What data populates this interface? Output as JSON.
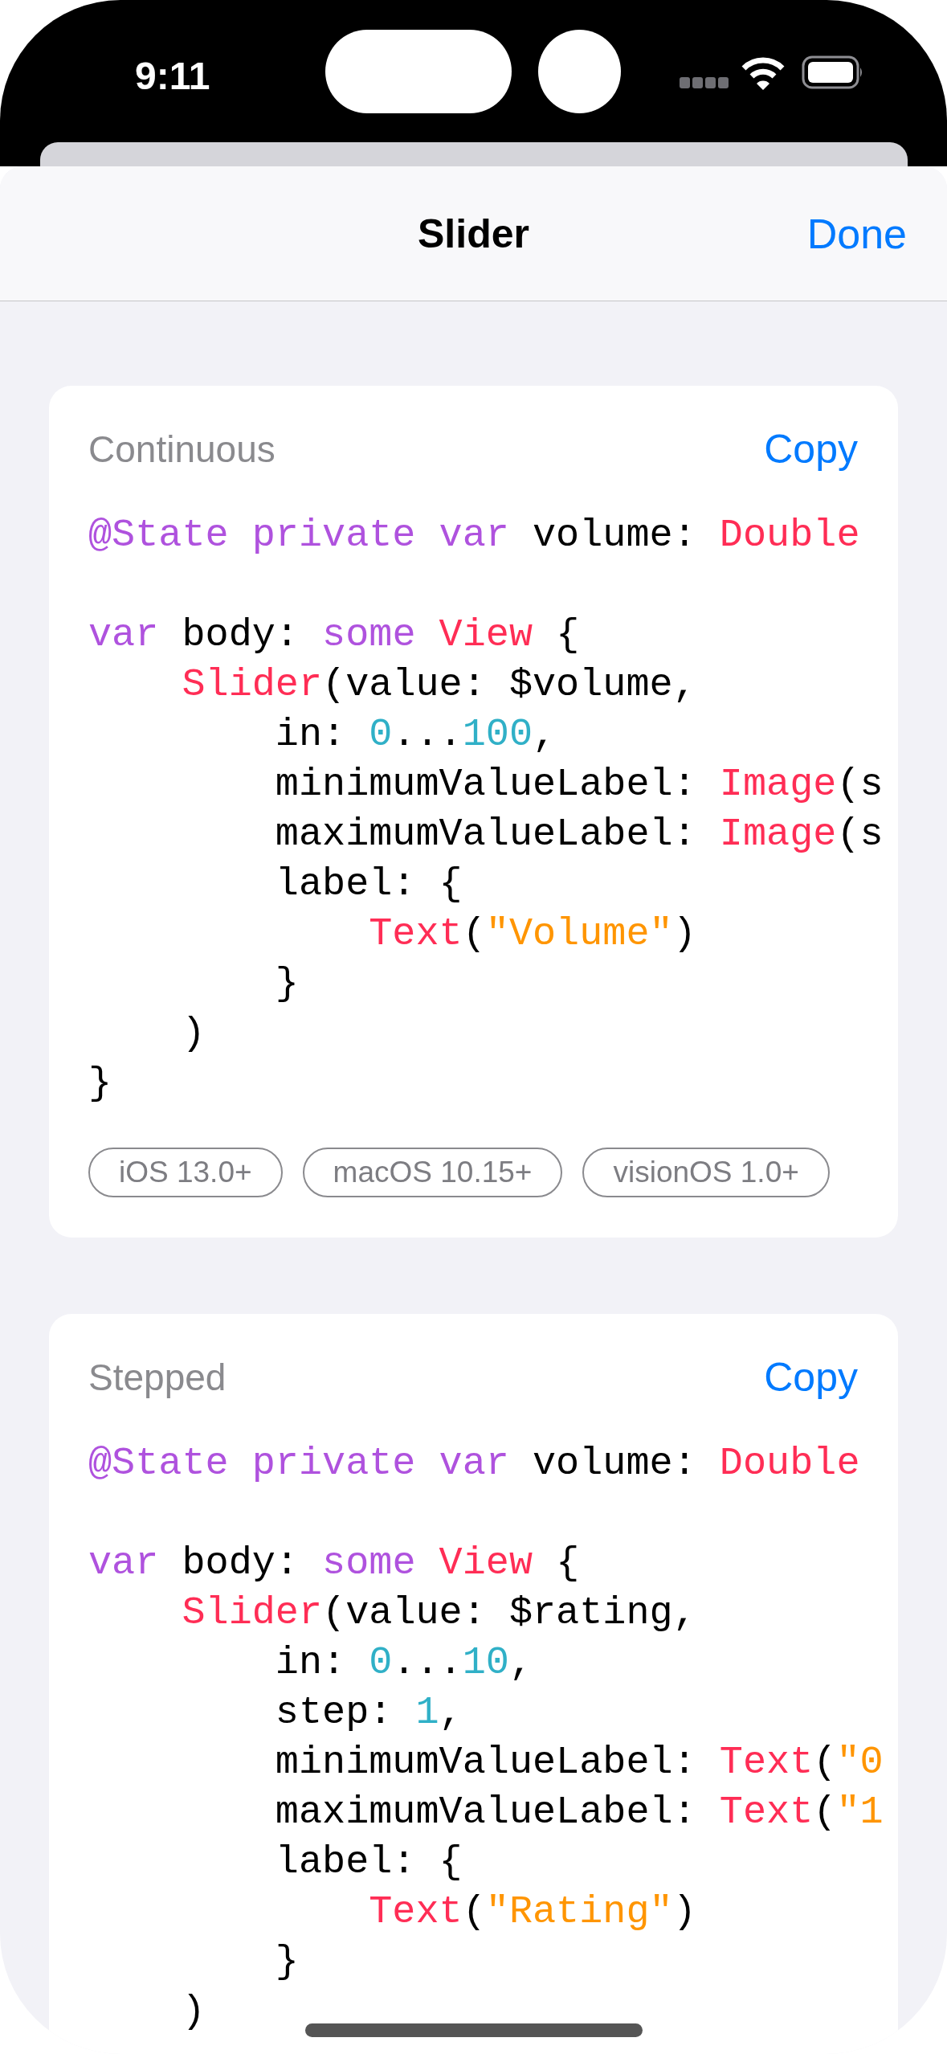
{
  "status_bar": {
    "time": "9:11"
  },
  "header": {
    "title": "Slider",
    "done": "Done"
  },
  "cards": [
    {
      "title": "Continuous",
      "copy": "Copy",
      "lines": [
        {
          "gap_before": false,
          "tokens": [
            {
              "text": "@State",
              "kind": "keyword"
            },
            {
              "text": " private",
              "kind": "keyword"
            },
            {
              "text": " var",
              "kind": "keyword"
            },
            {
              "text": " volume:",
              "kind": "plain"
            },
            {
              "text": " Double",
              "kind": "type"
            }
          ]
        },
        {
          "gap_before": true,
          "tokens": [
            {
              "text": "var",
              "kind": "keyword"
            },
            {
              "text": " body:",
              "kind": "plain"
            },
            {
              "text": " some",
              "kind": "keyword"
            },
            {
              "text": " View",
              "kind": "type"
            },
            {
              "text": " {",
              "kind": "plain"
            }
          ]
        },
        {
          "gap_before": false,
          "tokens": [
            {
              "text": "    Slider",
              "kind": "type"
            },
            {
              "text": "(value: $volume,",
              "kind": "plain"
            }
          ]
        },
        {
          "gap_before": false,
          "tokens": [
            {
              "text": "        in:",
              "kind": "plain"
            },
            {
              "text": " 0",
              "kind": "number"
            },
            {
              "text": "...",
              "kind": "plain"
            },
            {
              "text": "100",
              "kind": "number"
            },
            {
              "text": ",",
              "kind": "plain"
            }
          ]
        },
        {
          "gap_before": false,
          "tokens": [
            {
              "text": "        minimumValueLabel:",
              "kind": "plain"
            },
            {
              "text": " Image",
              "kind": "type"
            },
            {
              "text": "(s",
              "kind": "plain"
            }
          ]
        },
        {
          "gap_before": false,
          "tokens": [
            {
              "text": "        maximumValueLabel:",
              "kind": "plain"
            },
            {
              "text": " Image",
              "kind": "type"
            },
            {
              "text": "(s",
              "kind": "plain"
            }
          ]
        },
        {
          "gap_before": false,
          "tokens": [
            {
              "text": "        label: {",
              "kind": "plain"
            }
          ]
        },
        {
          "gap_before": false,
          "tokens": [
            {
              "text": "            Text",
              "kind": "type"
            },
            {
              "text": "(",
              "kind": "plain"
            },
            {
              "text": "\"Volume\"",
              "kind": "string"
            },
            {
              "text": ")",
              "kind": "plain"
            }
          ]
        },
        {
          "gap_before": false,
          "tokens": [
            {
              "text": "        }",
              "kind": "plain"
            }
          ]
        },
        {
          "gap_before": false,
          "tokens": [
            {
              "text": "    )",
              "kind": "plain"
            }
          ]
        },
        {
          "gap_before": false,
          "tokens": [
            {
              "text": "}",
              "kind": "plain"
            }
          ]
        }
      ],
      "platforms": [
        "iOS 13.0+",
        "macOS 10.15+",
        "visionOS 1.0+"
      ]
    },
    {
      "title": "Stepped",
      "copy": "Copy",
      "lines": [
        {
          "gap_before": false,
          "tokens": [
            {
              "text": "@State",
              "kind": "keyword"
            },
            {
              "text": " private",
              "kind": "keyword"
            },
            {
              "text": " var",
              "kind": "keyword"
            },
            {
              "text": " volume:",
              "kind": "plain"
            },
            {
              "text": " Double",
              "kind": "type"
            }
          ]
        },
        {
          "gap_before": true,
          "tokens": [
            {
              "text": "var",
              "kind": "keyword"
            },
            {
              "text": " body:",
              "kind": "plain"
            },
            {
              "text": " some",
              "kind": "keyword"
            },
            {
              "text": " View",
              "kind": "type"
            },
            {
              "text": " {",
              "kind": "plain"
            }
          ]
        },
        {
          "gap_before": false,
          "tokens": [
            {
              "text": "    Slider",
              "kind": "type"
            },
            {
              "text": "(value: $rating,",
              "kind": "plain"
            }
          ]
        },
        {
          "gap_before": false,
          "tokens": [
            {
              "text": "        in:",
              "kind": "plain"
            },
            {
              "text": " 0",
              "kind": "number"
            },
            {
              "text": "...",
              "kind": "plain"
            },
            {
              "text": "10",
              "kind": "number"
            },
            {
              "text": ",",
              "kind": "plain"
            }
          ]
        },
        {
          "gap_before": false,
          "tokens": [
            {
              "text": "        step:",
              "kind": "plain"
            },
            {
              "text": " 1",
              "kind": "number"
            },
            {
              "text": ",",
              "kind": "plain"
            }
          ]
        },
        {
          "gap_before": false,
          "tokens": [
            {
              "text": "        minimumValueLabel:",
              "kind": "plain"
            },
            {
              "text": " Text",
              "kind": "type"
            },
            {
              "text": "(",
              "kind": "plain"
            },
            {
              "text": "\"0",
              "kind": "string"
            }
          ]
        },
        {
          "gap_before": false,
          "tokens": [
            {
              "text": "        maximumValueLabel:",
              "kind": "plain"
            },
            {
              "text": " Text",
              "kind": "type"
            },
            {
              "text": "(",
              "kind": "plain"
            },
            {
              "text": "\"1",
              "kind": "string"
            }
          ]
        },
        {
          "gap_before": false,
          "tokens": [
            {
              "text": "        label: {",
              "kind": "plain"
            }
          ]
        },
        {
          "gap_before": false,
          "tokens": [
            {
              "text": "            Text",
              "kind": "type"
            },
            {
              "text": "(",
              "kind": "plain"
            },
            {
              "text": "\"Rating\"",
              "kind": "string"
            },
            {
              "text": ")",
              "kind": "plain"
            }
          ]
        },
        {
          "gap_before": false,
          "tokens": [
            {
              "text": "        }",
              "kind": "plain"
            }
          ]
        },
        {
          "gap_before": false,
          "tokens": [
            {
              "text": "    )",
              "kind": "plain"
            }
          ]
        }
      ]
    }
  ]
}
